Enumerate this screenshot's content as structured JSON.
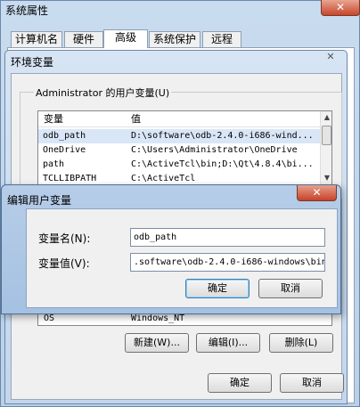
{
  "system_window": {
    "title": "系统属性",
    "close_glyph": "✕",
    "tabs": [
      {
        "label": "计算机名",
        "active": false
      },
      {
        "label": "硬件",
        "active": false
      },
      {
        "label": "高级",
        "active": true
      },
      {
        "label": "系统保护",
        "active": false
      },
      {
        "label": "远程",
        "active": false
      }
    ]
  },
  "env_window": {
    "title": "环境变量",
    "close_glyph": "✕",
    "user_vars_label": "Administrator 的用户变量(U)",
    "columns": {
      "name": "变量",
      "value": "值"
    },
    "user_vars": [
      {
        "name": "odb_path",
        "value": "D:\\software\\odb-2.4.0-i686-wind..."
      },
      {
        "name": "OneDrive",
        "value": "C:\\Users\\Administrator\\OneDrive"
      },
      {
        "name": "path",
        "value": "C:\\ActiveTcl\\bin;D:\\Qt\\4.8.4\\bi..."
      },
      {
        "name": "TCLLIBPATH",
        "value": "C:\\ActiveTcl"
      }
    ],
    "system_var_row": {
      "name": "OS",
      "value": "Windows_NT"
    },
    "buttons": {
      "new": "新建(W)...",
      "edit": "编辑(I)...",
      "delete": "删除(L)"
    },
    "ok": "确定",
    "cancel": "取消"
  },
  "edit_dialog": {
    "title": "编辑用户变量",
    "close_glyph": "✕",
    "name_label": "变量名(N):",
    "name_value": "odb_path",
    "value_label": "变量值(V):",
    "value_value": ".software\\odb-2.4.0-i686-windows\\bin",
    "ok": "确定",
    "cancel": "取消"
  }
}
